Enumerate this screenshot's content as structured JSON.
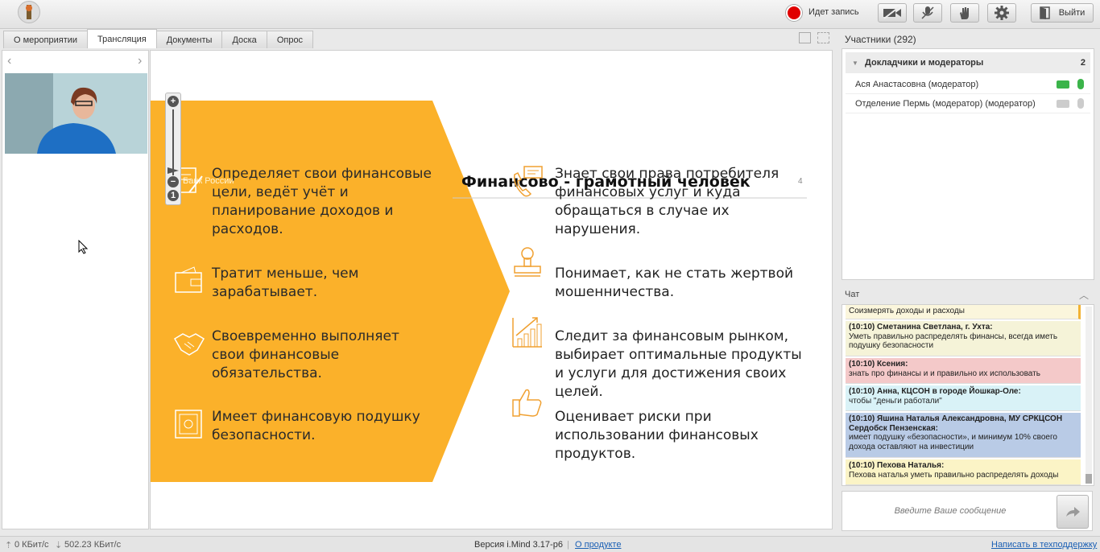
{
  "topbar": {
    "recording_label": "Идет запись",
    "exit_label": "Выйти",
    "icons": [
      "camera-off-icon",
      "mic-off-icon",
      "raise-hand-icon",
      "settings-gear-icon",
      "exit-door-icon"
    ],
    "record_color": "#e00000"
  },
  "tabs": [
    "О мероприятии",
    "Трансляция",
    "Документы",
    "Доска",
    "Опрос"
  ],
  "active_tab": "Трансляция",
  "slide": {
    "bank_label": "Банк России",
    "title": "Финансово - грамотный человек",
    "page_number": "4",
    "accent_color": "#fbb12a",
    "left_items": [
      {
        "icon": "document-pen-icon",
        "text": "Определяет свои финансовые цели, ведёт учёт и планирование доходов и расходов."
      },
      {
        "icon": "wallet-icon",
        "text": "Тратит меньше, чем зарабатывает."
      },
      {
        "icon": "handshake-icon",
        "text": "Своевременно выполняет свои финансовые обязательства."
      },
      {
        "icon": "safe-icon",
        "text": "Имеет финансовую подушку безопасности."
      }
    ],
    "right_items": [
      {
        "icon": "phone-chat-icon",
        "text": "Знает свои права потребителя финансовых услуг и куда обращаться в случае их нарушения."
      },
      {
        "icon": "stamp-icon",
        "text": "Понимает, как не стать жертвой мошенничества."
      },
      {
        "icon": "growth-chart-icon",
        "text": "Следит за финансовым рынком, выбирает оптимальные продукты и услуги для достижения своих целей."
      },
      {
        "icon": "thumbs-up-icon",
        "text": "Оценивает риски при использовании финансовых продуктов."
      }
    ]
  },
  "participants": {
    "title": "Участники (292)",
    "group_label": "Докладчики и модераторы",
    "group_count": "2",
    "rows": [
      {
        "name": "Ася Анастасовна (модератор)",
        "active": true
      },
      {
        "name": "Отделение Пермь (модератор) (модератор)",
        "active": false
      }
    ]
  },
  "chat": {
    "title": "Чат",
    "messages": [
      {
        "author": "",
        "text": "Соизмерять доходы и расходы",
        "color": "#fbf6dc"
      },
      {
        "author": "(10:10) Сметанина Светлана, г. Ухта:",
        "text": "Уметь правильно распределять финансы, всегда иметь подушку безопасности",
        "color": "#f5f3d8"
      },
      {
        "author": "(10:10) Ксения:",
        "text": "знать про финансы и и правильно их использовать",
        "color": "#f4c9c9"
      },
      {
        "author": "(10:10) Анна, КЦСОН в городе Йошкар-Оле:",
        "text": "чтобы \"деньги работали\"",
        "color": "#d9f2f7"
      },
      {
        "author": "(10:10) Яшина Наталья Александровна, МУ СРКЦСОН Сердобск Пензенская:",
        "text": "имеет подушку «безопасности», и минимум 10% своего дохода оставляют на инвестиции",
        "color": "#b9cbe6"
      },
      {
        "author": "(10:10) Пехова Наталья:",
        "text": "Пехова наталья уметь правильно распределять доходы",
        "color": "#fbf4c6"
      }
    ],
    "input_placeholder": "Введите Ваше сообщение"
  },
  "statusbar": {
    "upload": "0 КБит/с",
    "download": "502.23 КБит/с",
    "version": "Версия i.Mind 3.17-p6",
    "about_link": "О продукте",
    "support_link": "Написать в техподдержку"
  }
}
